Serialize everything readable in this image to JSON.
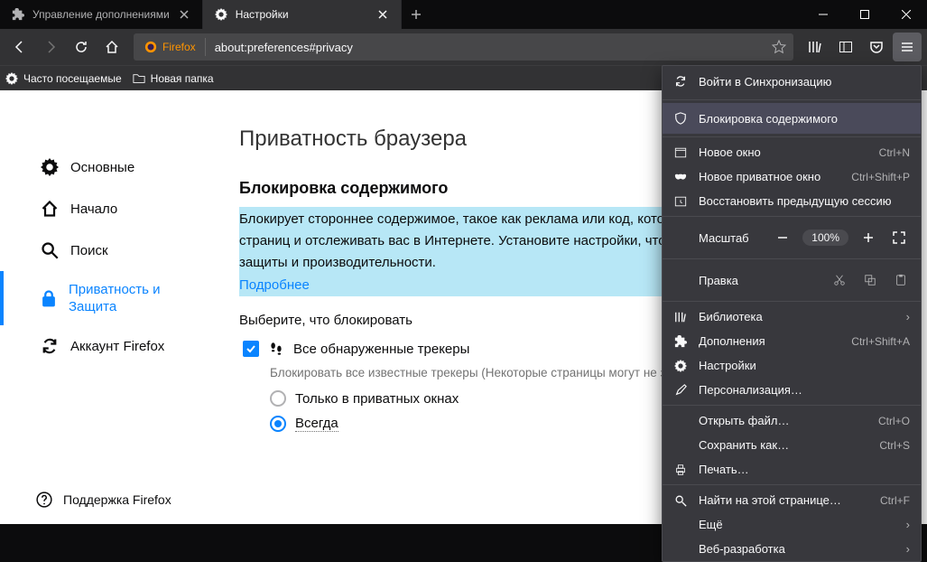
{
  "tabs": [
    {
      "title": "Управление дополнениями"
    },
    {
      "title": "Настройки"
    }
  ],
  "url": {
    "identity": "Firefox",
    "text": "about:preferences#privacy"
  },
  "bookmarks": {
    "most_visited": "Часто посещаемые",
    "new_folder": "Новая папка"
  },
  "sidebar": {
    "categories": [
      {
        "label": "Основные"
      },
      {
        "label": "Начало"
      },
      {
        "label": "Поиск"
      },
      {
        "label": "Приватность и Защита"
      },
      {
        "label": "Аккаунт Firefox"
      }
    ],
    "support": "Поддержка Firefox"
  },
  "main": {
    "h1": "Приватность браузера",
    "h2": "Блокировка содержимого",
    "desc": "Блокирует стороннее содержимое, такое как реклама или код, которое может замедлить просмотр страниц и отслеживать вас в Интернете. Установите настройки, чтобы обеспечить наилучший баланс защиты и производительности.",
    "learn_more": "Подробнее",
    "choose": "Выберите, что блокировать",
    "opt_trackers": "Все обнаруженные трекеры",
    "opt_trackers_sub": "Блокировать все известные трекеры (Некоторые страницы могут не загрузиться)",
    "radio_private": "Только в приватных окнах",
    "radio_always": "Всегда"
  },
  "menu": {
    "sync": "Войти в Синхронизацию",
    "content_blocking": "Блокировка содержимого",
    "new_window": "Новое окно",
    "new_window_sc": "Ctrl+N",
    "new_private": "Новое приватное окно",
    "new_private_sc": "Ctrl+Shift+P",
    "restore": "Восстановить предыдущую сессию",
    "zoom_label": "Масштаб",
    "zoom_value": "100%",
    "edit_label": "Правка",
    "library": "Библиотека",
    "addons": "Дополнения",
    "addons_sc": "Ctrl+Shift+A",
    "settings": "Настройки",
    "customize": "Персонализация…",
    "open_file": "Открыть файл…",
    "open_file_sc": "Ctrl+O",
    "save_as": "Сохранить как…",
    "save_as_sc": "Ctrl+S",
    "print": "Печать…",
    "find": "Найти на этой странице…",
    "find_sc": "Ctrl+F",
    "more": "Ещё",
    "dev": "Веб-разработка"
  }
}
